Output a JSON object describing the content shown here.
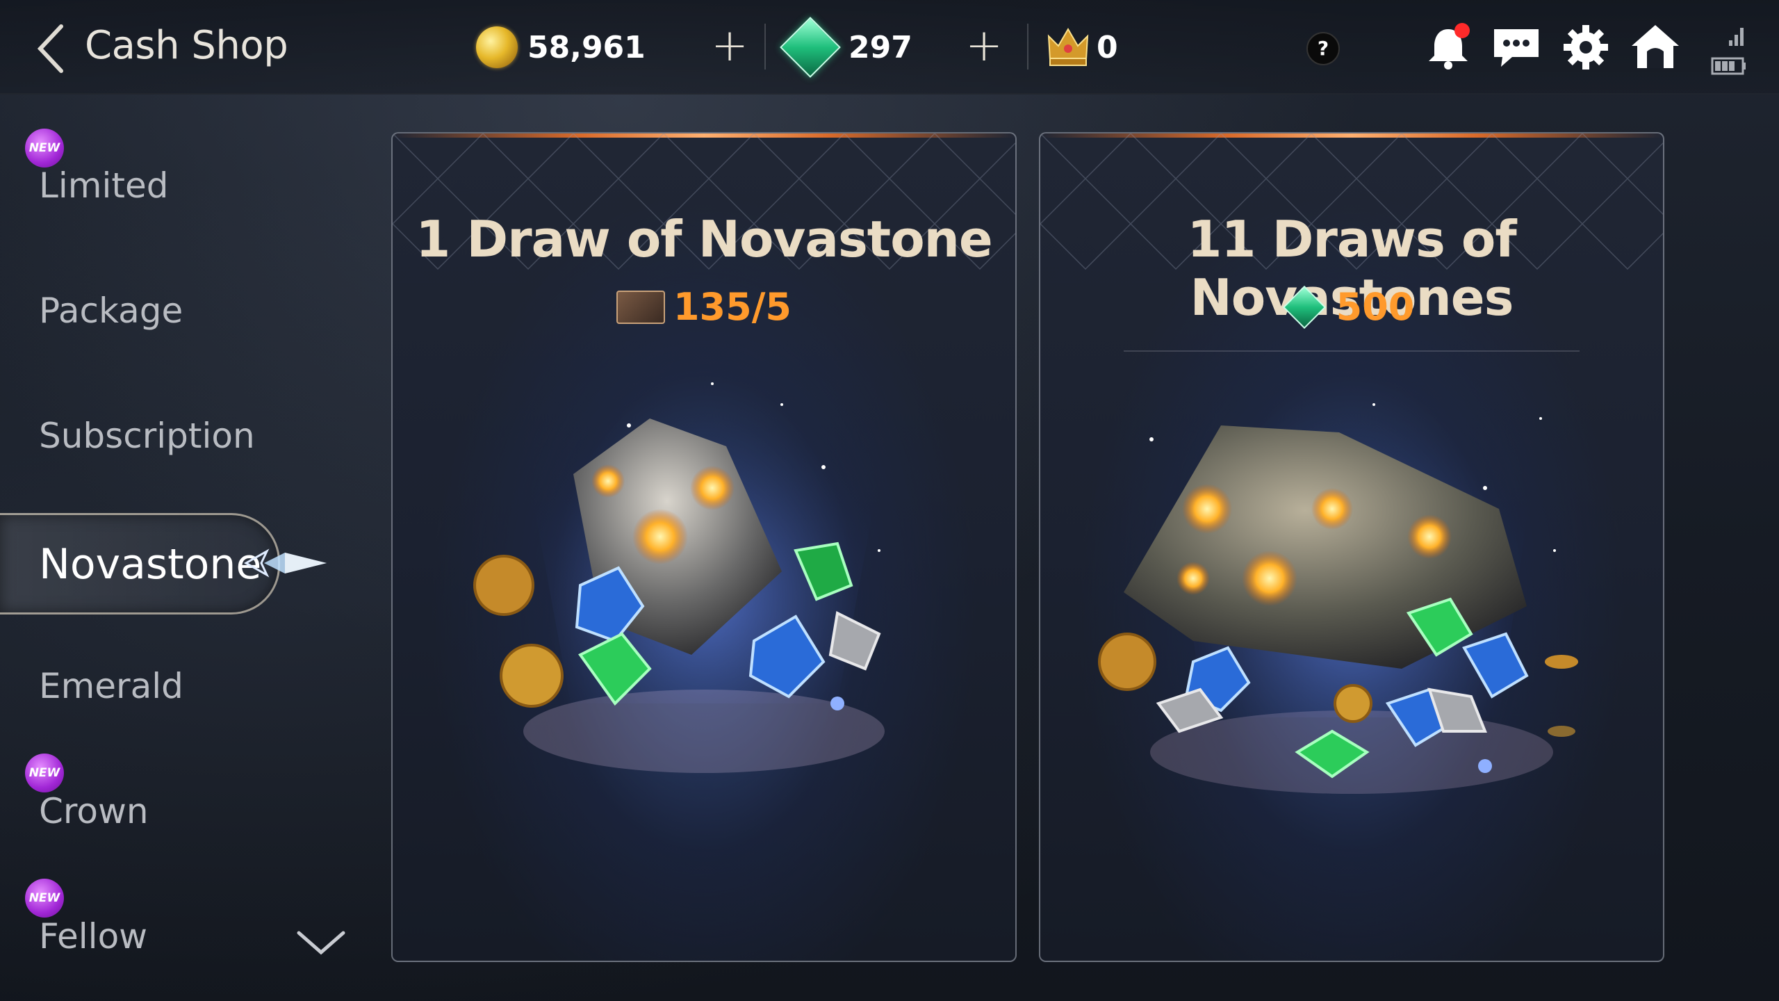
{
  "header": {
    "title": "Cash Shop",
    "gold": "58,961",
    "emerald": "297",
    "crown": "0",
    "help": "?"
  },
  "sidebar": {
    "items": [
      {
        "label": "Limited",
        "badge": "NEW"
      },
      {
        "label": "Package"
      },
      {
        "label": "Subscription"
      },
      {
        "label": "Novastone"
      },
      {
        "label": "Emerald"
      },
      {
        "label": "Crown",
        "badge": "NEW"
      },
      {
        "label": "Fellow",
        "badge": "NEW"
      }
    ]
  },
  "cards": [
    {
      "title": "1 Draw of Novastone",
      "price": "135/5",
      "currency_icon": "ticket-icon"
    },
    {
      "title": "11 Draws of Novastones",
      "price": "500",
      "currency_icon": "emerald-icon"
    }
  ],
  "colors": {
    "accent": "#ff9a2c",
    "badge": "#a127d6",
    "emerald": "#1fbf7c"
  }
}
